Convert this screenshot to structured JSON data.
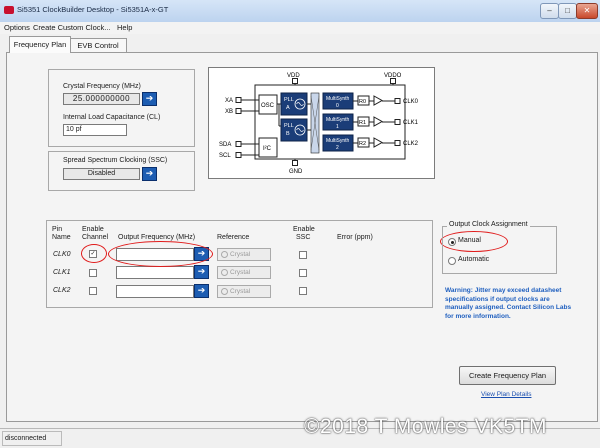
{
  "window": {
    "title": "Si5351 ClockBuilder Desktop - Si5351A-x-GT",
    "controls": [
      "–",
      "□",
      "✕"
    ]
  },
  "menu": [
    "Options",
    "Create Custom Clock...",
    "Help"
  ],
  "tabs": [
    {
      "label": "Frequency Plan",
      "active": true
    },
    {
      "label": "EVB Control",
      "active": false
    }
  ],
  "crystal": {
    "freq_label": "Crystal Frequency (MHz)",
    "freq_value": "25.000000000",
    "load_label": "Internal Load Capacitance (CL)",
    "load_value": "10 pf"
  },
  "ssc": {
    "label": "Spread Spectrum Clocking (SSC)",
    "value": "Disabled"
  },
  "diagram": {
    "vdd": "VDD",
    "vddo": "VDDO",
    "gnd": "GND",
    "xa": "XA",
    "xb": "XB",
    "sda": "SDA",
    "scl": "SCL",
    "osc": "OSC",
    "i2c": "I²C",
    "pll_a": [
      "PLL",
      "A"
    ],
    "pll_b": [
      "PLL",
      "B"
    ],
    "multisynth": [
      {
        "name": "MultiSynth",
        "num": "0",
        "r": "R0",
        "clk": "CLK0"
      },
      {
        "name": "MultiSynth",
        "num": "1",
        "r": "R1",
        "clk": "CLK1"
      },
      {
        "name": "MultiSynth",
        "num": "2",
        "r": "R2",
        "clk": "CLK2"
      }
    ]
  },
  "table": {
    "headers": {
      "pin": [
        "Pin",
        "Name"
      ],
      "enable": [
        "Enable",
        "Channel"
      ],
      "outfreq": "Output Frequency (MHz)",
      "reference": "Reference",
      "ssc": [
        "Enable",
        "SSC"
      ],
      "error": "Error (ppm)"
    },
    "rows": [
      {
        "pin": "CLK0",
        "enabled": true,
        "freq": "",
        "reference": "Crystal"
      },
      {
        "pin": "CLK1",
        "enabled": false,
        "freq": "",
        "reference": "Crystal"
      },
      {
        "pin": "CLK2",
        "enabled": false,
        "freq": "",
        "reference": "Crystal"
      }
    ]
  },
  "assignment": {
    "title": "Output Clock Assignment",
    "manual": "Manual",
    "automatic": "Automatic",
    "selected": "Manual"
  },
  "warning": "Warning: Jitter may exceed datasheet specifications if output clocks are manually assigned. Contact Silicon Labs for more information.",
  "actions": {
    "create": "Create Frequency Plan",
    "view": "View Plan Details"
  },
  "status": "disconnected",
  "watermark": "©2018 T Mowles VK5TM",
  "colors": {
    "accent": "#1d5db2",
    "warning": "#1f5fbf",
    "highlight": "#e01b1b",
    "block": "#1b3d78"
  }
}
